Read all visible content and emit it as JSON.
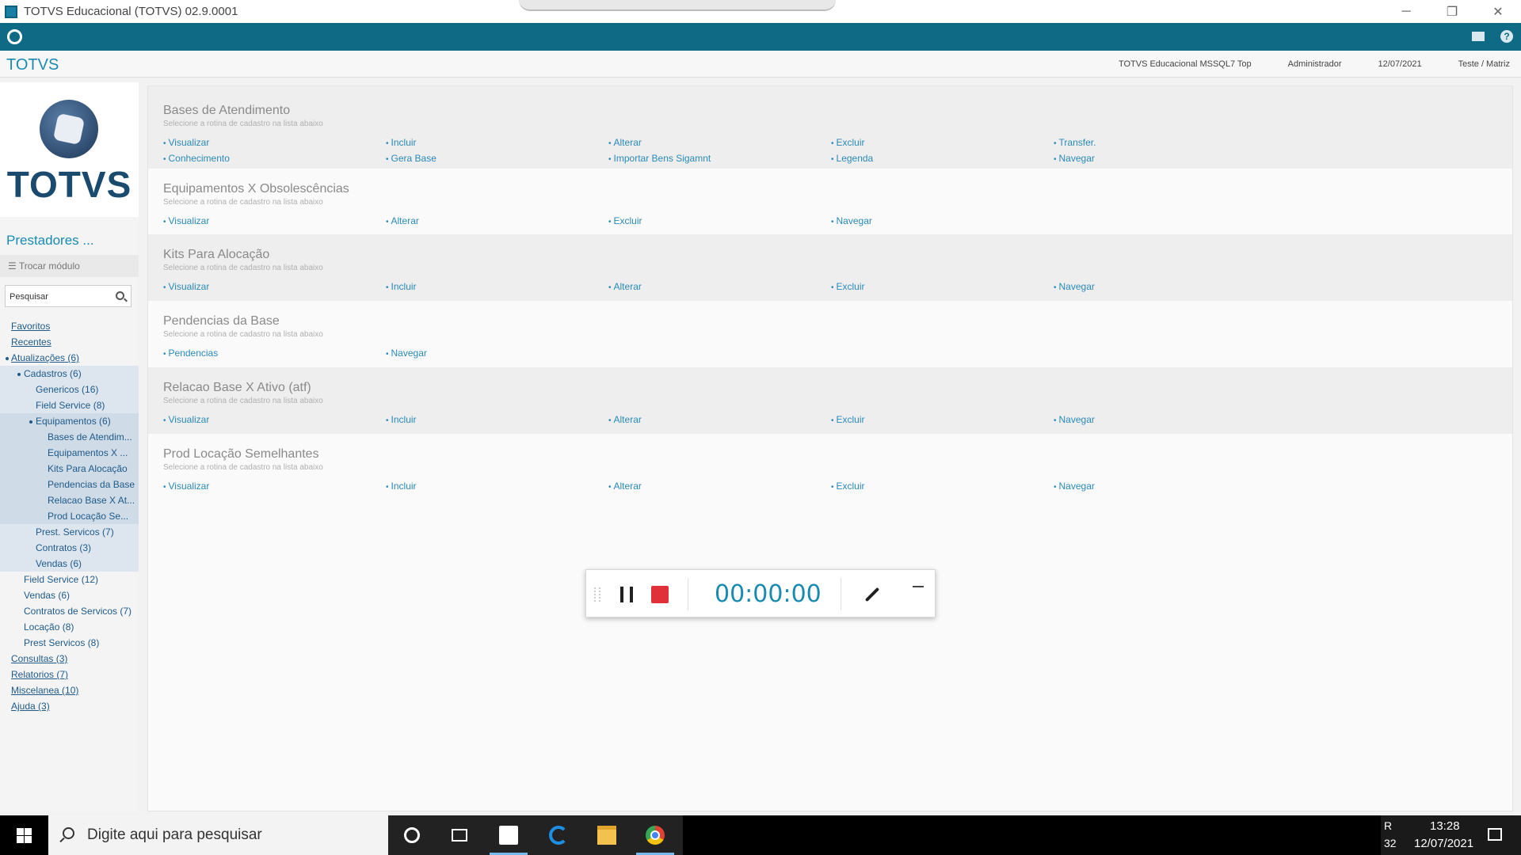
{
  "window": {
    "title": "TOTVS Educacional (TOTVS) 02.9.0001",
    "controls": [
      "─",
      "❐",
      "✕"
    ]
  },
  "header": {
    "brand": "TOTVS",
    "environment": "TOTVS Educacional MSSQL7 Top",
    "user": "Administrador",
    "date": "12/07/2021",
    "branch": "Teste / Matriz"
  },
  "sidebar": {
    "logo_text": "TOTVS",
    "module_title": "Prestadores ...",
    "switch_module": "☰ Trocar módulo",
    "search_placeholder": "Pesquisar",
    "tree": [
      {
        "label": "Favoritos",
        "level": 0
      },
      {
        "label": "Recentes",
        "level": 0
      },
      {
        "label": "Atualizações (6)",
        "level": 0,
        "bullet": true
      },
      {
        "label": "Cadastros (6)",
        "level": 1,
        "bullet": true
      },
      {
        "label": "Genericos (16)",
        "level": 2
      },
      {
        "label": "Field Service (8)",
        "level": 2
      },
      {
        "label": "Equipamentos (6)",
        "level": 2,
        "bullet": true
      },
      {
        "label": "Bases de Atendim...",
        "level": 3
      },
      {
        "label": "Equipamentos X ...",
        "level": 3
      },
      {
        "label": "Kits Para Alocação",
        "level": 3
      },
      {
        "label": "Pendencias da Base",
        "level": 3
      },
      {
        "label": "Relacao Base X At...",
        "level": 3
      },
      {
        "label": "Prod Locação Se...",
        "level": 3
      },
      {
        "label": "Prest. Servicos (7)",
        "level": 2
      },
      {
        "label": "Contratos (3)",
        "level": 2
      },
      {
        "label": "Vendas (6)",
        "level": 2
      },
      {
        "label": "Field Service (12)",
        "level": 1
      },
      {
        "label": "Vendas (6)",
        "level": 1
      },
      {
        "label": "Contratos de Servicos (7)",
        "level": 1
      },
      {
        "label": "Locação (8)",
        "level": 1
      },
      {
        "label": "Prest Servicos (8)",
        "level": 1
      },
      {
        "label": "Consultas (3)",
        "level": 0
      },
      {
        "label": "Relatorios (7)",
        "level": 0
      },
      {
        "label": "Miscelanea (10)",
        "level": 0
      },
      {
        "label": "Ajuda (3)",
        "level": 0
      }
    ]
  },
  "main": {
    "subtitle": "Selecione a rotina de cadastro na lista abaixo",
    "sections": [
      {
        "title": "Bases de Atendimento",
        "rows": [
          [
            "Visualizar",
            "Incluir",
            "Alterar",
            "Excluir",
            "Transfer."
          ],
          [
            "Conhecimento",
            "Gera Base",
            "Importar Bens Sigamnt",
            "Legenda",
            "Navegar"
          ]
        ]
      },
      {
        "title": "Equipamentos X Obsolescências",
        "rows": [
          [
            "Visualizar",
            "Alterar",
            "Excluir",
            "Navegar"
          ]
        ]
      },
      {
        "title": "Kits Para Alocação",
        "rows": [
          [
            "Visualizar",
            "Incluir",
            "Alterar",
            "Excluir",
            "Navegar"
          ]
        ]
      },
      {
        "title": "Pendencias da Base",
        "rows": [
          [
            "Pendencias",
            "Navegar"
          ]
        ]
      },
      {
        "title": "Relacao Base X Ativo (atf)",
        "rows": [
          [
            "Visualizar",
            "Incluir",
            "Alterar",
            "Excluir",
            "Navegar"
          ]
        ]
      },
      {
        "title": "Prod Locação Semelhantes",
        "rows": [
          [
            "Visualizar",
            "Incluir",
            "Alterar",
            "Excluir",
            "Navegar"
          ]
        ]
      }
    ]
  },
  "recorder": {
    "timer": "00:00:00"
  },
  "taskbar": {
    "search_placeholder": "Digite aqui para pesquisar",
    "tray_partial_1": "R",
    "tray_partial_2": "32",
    "time": "13:28",
    "date": "12/07/2021"
  },
  "colors": {
    "topbar": "#0f6b85",
    "link": "#2a8ab8",
    "brand": "#1a8bb0",
    "stop": "#e0303a"
  }
}
